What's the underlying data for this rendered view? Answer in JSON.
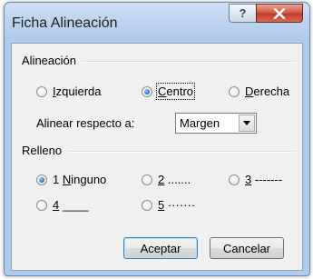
{
  "window": {
    "title": "Ficha Alineación",
    "help_icon": "question-mark-icon",
    "close_icon": "close-x-icon"
  },
  "alignment_group": {
    "label": "Alineación",
    "options": [
      {
        "pre": "",
        "key": "I",
        "post": "zquierda",
        "checked": false
      },
      {
        "pre": "",
        "key": "C",
        "post": "entro",
        "checked": true
      },
      {
        "pre": "",
        "key": "D",
        "post": "erecha",
        "checked": false
      }
    ],
    "align_relative_label": "Alinear respecto a:",
    "align_relative_value": "Margen",
    "dropdown_icon": "chevron-down-icon"
  },
  "leader_group": {
    "label": "Relleno",
    "options": [
      {
        "pre": "1 ",
        "key": "N",
        "post": "inguno",
        "checked": true
      },
      {
        "pre": "",
        "key": "2",
        "post": " .......",
        "checked": false
      },
      {
        "pre": "",
        "key": "3",
        "post": " -------",
        "checked": false
      },
      {
        "pre": "",
        "key": "4",
        "post": " ____",
        "checked": false
      },
      {
        "pre": "",
        "key": "5",
        "post": " ·······",
        "checked": false
      }
    ]
  },
  "buttons": {
    "ok": "Aceptar",
    "cancel": "Cancelar"
  },
  "colors": {
    "title_bar": "#bcd3ee",
    "close_button": "#c0392b",
    "radio_checked": "#2e7fd6",
    "default_button_border": "#3c7fb1"
  }
}
